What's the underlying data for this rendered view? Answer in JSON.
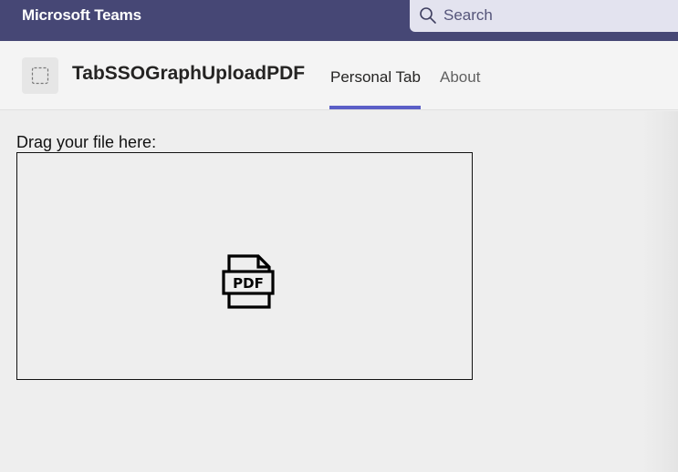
{
  "topbar": {
    "app_title": "Microsoft Teams",
    "search": {
      "placeholder": "Search",
      "value": ""
    }
  },
  "header": {
    "app_name": "TabSSOGraphUploadPDF",
    "tabs": [
      {
        "label": "Personal Tab",
        "active": true
      },
      {
        "label": "About",
        "active": false
      }
    ]
  },
  "main": {
    "drop_label": "Drag your file here:",
    "drop_icon": "pdf-file-icon"
  },
  "colors": {
    "topbar": "#464775",
    "accent": "#5b5fc7",
    "background": "#eeeeee"
  }
}
